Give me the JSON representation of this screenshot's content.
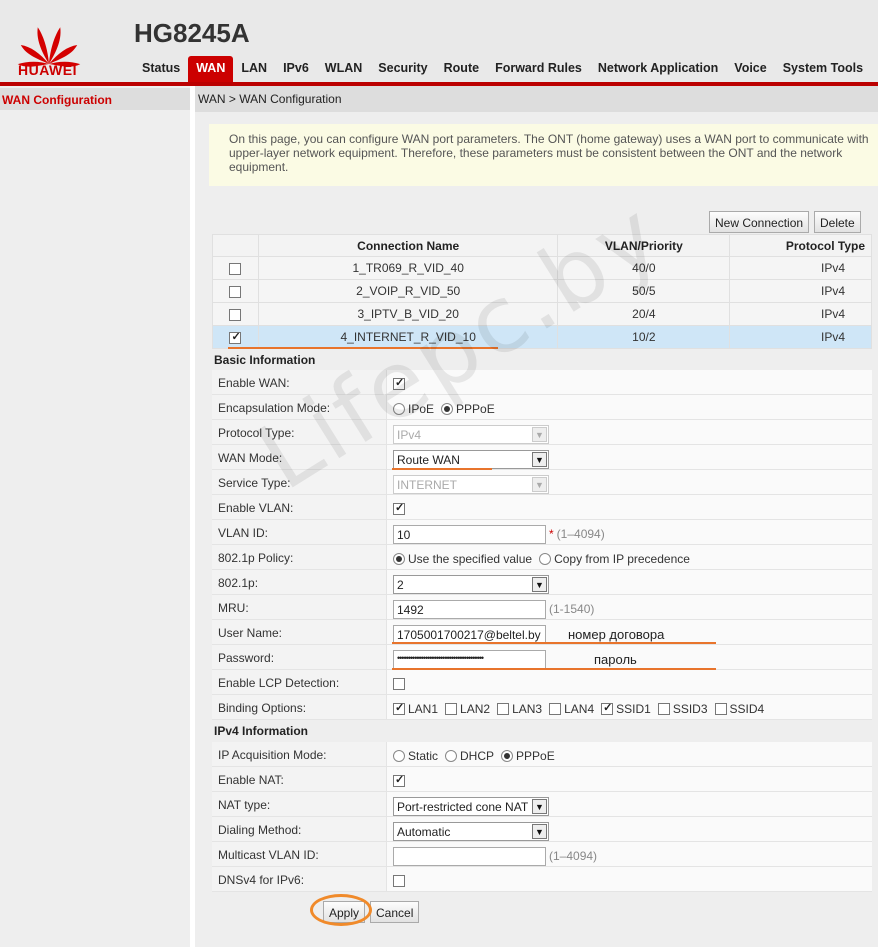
{
  "brand": "HUAWEI",
  "model": "HG8245A",
  "nav": [
    "Status",
    "WAN",
    "LAN",
    "IPv6",
    "WLAN",
    "Security",
    "Route",
    "Forward Rules",
    "Network Application",
    "Voice",
    "System Tools"
  ],
  "sidebar": {
    "item": "WAN Configuration"
  },
  "breadcrumb": "WAN > WAN Configuration",
  "notice": "On this page, you can configure WAN port parameters. The ONT (home gateway) uses a WAN port to communicate with upper-layer network equipment. Therefore, these parameters must be consistent between the ONT and the network equipment.",
  "buttons": {
    "new_connection": "New Connection",
    "delete": "Delete",
    "apply": "Apply",
    "cancel": "Cancel"
  },
  "table": {
    "headers": [
      "Connection Name",
      "VLAN/Priority",
      "Protocol Type"
    ],
    "rows": [
      {
        "name": "1_TR069_R_VID_40",
        "vlan": "40/0",
        "proto": "IPv4",
        "checked": false
      },
      {
        "name": "2_VOIP_R_VID_50",
        "vlan": "50/5",
        "proto": "IPv4",
        "checked": false
      },
      {
        "name": "3_IPTV_B_VID_20",
        "vlan": "20/4",
        "proto": "IPv4",
        "checked": false
      },
      {
        "name": "4_INTERNET_R_VID_10",
        "vlan": "10/2",
        "proto": "IPv4",
        "checked": true
      }
    ]
  },
  "basic": {
    "title": "Basic Information",
    "labels": {
      "enable_wan": "Enable WAN:",
      "encap": "Encapsulation Mode:",
      "protocol": "Protocol Type:",
      "wan_mode": "WAN Mode:",
      "service": "Service Type:",
      "enable_vlan": "Enable VLAN:",
      "vlan_id": "VLAN ID:",
      "policy": "802.1p Policy:",
      "p8021": "802.1p:",
      "mru": "MRU:",
      "username": "User Name:",
      "password": "Password:",
      "lcp": "Enable LCP Detection:",
      "binding": "Binding Options:"
    },
    "encap_options": [
      "IPoE",
      "PPPoE"
    ],
    "protocol_value": "IPv4",
    "wan_mode_value": "Route WAN",
    "service_value": "INTERNET",
    "vlan_id_value": "10",
    "vlan_id_req": "*",
    "vlan_id_hint": "(1–4094)",
    "policy_options": [
      "Use the specified value",
      "Copy from IP precedence"
    ],
    "p8021_value": "2",
    "mru_value": "1492",
    "mru_hint": "(1-1540)",
    "username_value": "1705001700217@beltel.by",
    "password_value": "••••••••••••••••••••••••••••••••••••••••",
    "binding_options": [
      "LAN1",
      "LAN2",
      "LAN3",
      "LAN4",
      "SSID1",
      "SSID3",
      "SSID4"
    ]
  },
  "ipv4": {
    "title": "IPv4 Information",
    "labels": {
      "acq": "IP Acquisition Mode:",
      "nat": "Enable NAT:",
      "nat_type": "NAT type:",
      "dial": "Dialing Method:",
      "mcast": "Multicast VLAN ID:",
      "dnsv4": "DNSv4 for IPv6:"
    },
    "acq_options": [
      "Static",
      "DHCP",
      "PPPoE"
    ],
    "nat_type_value": "Port-restricted cone NAT",
    "dial_value": "Automatic",
    "mcast_hint": "(1–4094)"
  },
  "annotations": {
    "contract": "номер договора",
    "password": "пароль"
  },
  "watermark": "Lifepc.by",
  "colors": {
    "brand_red": "#cc0000",
    "annotation_orange": "#e8742c",
    "selected_row": "#cfe6f7"
  }
}
